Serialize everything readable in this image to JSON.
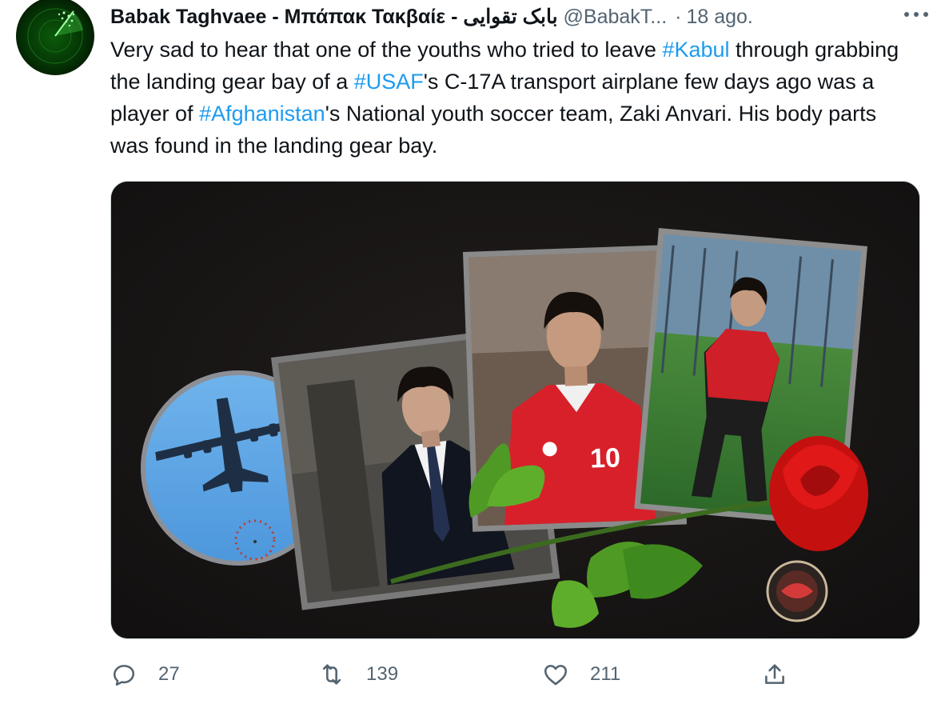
{
  "tweet": {
    "author_name": "Babak Taghvaee - Μπάπακ Τακβαίε - بابک تقوایی",
    "author_handle": "@BabakT...",
    "separator": "·",
    "time": "18 ago.",
    "text_parts": [
      {
        "text": "Very sad to hear that one of the youths who tried to leave ",
        "hashtag": false
      },
      {
        "text": "#Kabul",
        "hashtag": true
      },
      {
        "text": " through grabbing the landing gear bay of a ",
        "hashtag": false
      },
      {
        "text": "#USAF",
        "hashtag": true
      },
      {
        "text": "'s C-17A transport airplane few days ago was a player of ",
        "hashtag": false
      },
      {
        "text": "#Afghanistan",
        "hashtag": true
      },
      {
        "text": "'s National youth soccer team, Zaki Anvari. His body parts was found in the landing gear bay.",
        "hashtag": false
      }
    ],
    "media": {
      "jersey_number": "10",
      "background_color": "#171515"
    },
    "actions": {
      "reply_count": "27",
      "retweet_count": "139",
      "like_count": "211"
    }
  },
  "colors": {
    "hashtag": "#1d9bf0",
    "secondary_text": "#536471",
    "primary_text": "#0f1419"
  },
  "icons": [
    "more-icon",
    "reply-icon",
    "retweet-icon",
    "like-icon",
    "share-icon"
  ]
}
